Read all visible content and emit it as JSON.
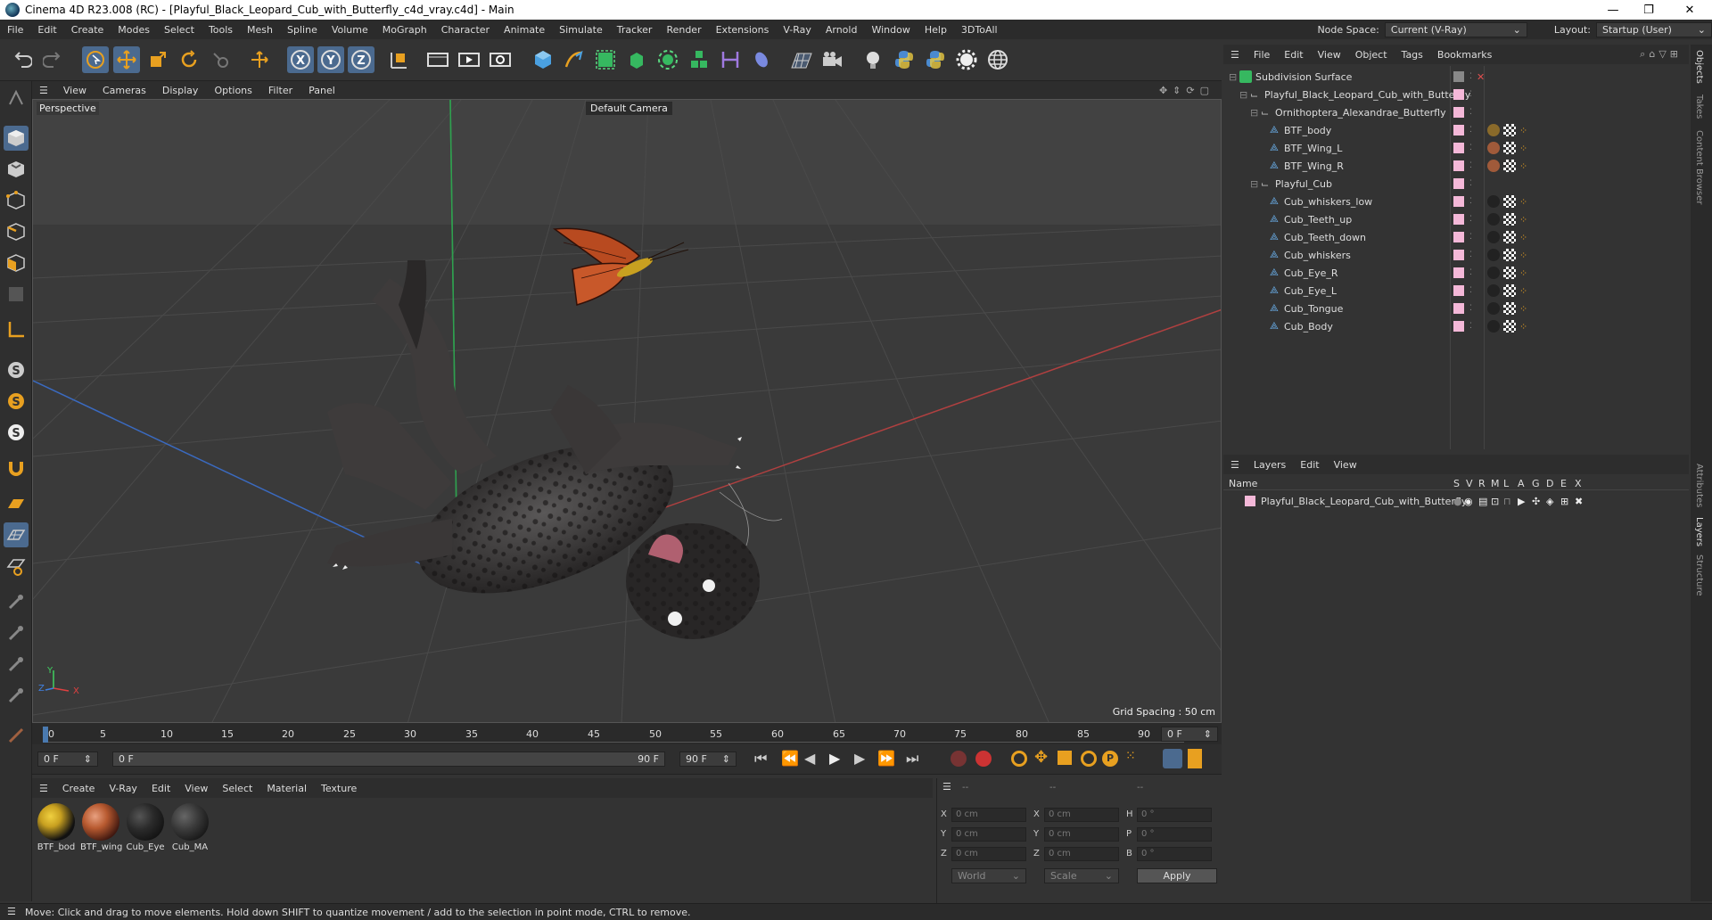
{
  "window": {
    "title": "Cinema 4D R23.008 (RC) - [Playful_Black_Leopard_Cub_with_Butterfly_c4d_vray.c4d] - Main",
    "minimize": "—",
    "maximize": "❐",
    "close": "✕"
  },
  "menubar": {
    "items": [
      "File",
      "Edit",
      "Create",
      "Modes",
      "Select",
      "Tools",
      "Mesh",
      "Spline",
      "Volume",
      "MoGraph",
      "Character",
      "Animate",
      "Simulate",
      "Tracker",
      "Render",
      "Extensions",
      "V-Ray",
      "Arnold",
      "Window",
      "Help",
      "3DToAll"
    ],
    "node_space_label": "Node Space:",
    "node_space_value": "Current (V-Ray)",
    "layout_label": "Layout:",
    "layout_value": "Startup (User)"
  },
  "viewport": {
    "menu": [
      "View",
      "Cameras",
      "Display",
      "Options",
      "Filter",
      "Panel"
    ],
    "view_name": "Perspective",
    "camera_name": "Default Camera",
    "grid_spacing": "Grid Spacing : 50 cm",
    "axis_y": "Y",
    "axis_x": "X",
    "axis_z": "Z"
  },
  "timeline": {
    "ticks": [
      "0",
      "5",
      "10",
      "15",
      "20",
      "25",
      "30",
      "35",
      "40",
      "45",
      "50",
      "55",
      "60",
      "65",
      "70",
      "75",
      "80",
      "85",
      "90"
    ],
    "current_frame_right": "0 F",
    "start_field": "0 F",
    "range_start": "0 F",
    "range_end": "90 F",
    "end_field": "90 F"
  },
  "materials": {
    "menu": [
      "Create",
      "V-Ray",
      "Edit",
      "View",
      "Select",
      "Material",
      "Texture"
    ],
    "items": [
      {
        "name": "BTF_bod",
        "color": "#c8a020"
      },
      {
        "name": "BTF_wing",
        "color": "#b85a30"
      },
      {
        "name": "Cub_Eye",
        "color": "#2a2a2a"
      },
      {
        "name": "Cub_MA",
        "color": "#3a3a3a"
      }
    ]
  },
  "coords": {
    "headers": [
      "--",
      "--",
      "--"
    ],
    "rows": [
      {
        "a": "X",
        "av": "0 cm",
        "b": "X",
        "bv": "0 cm",
        "c": "H",
        "cv": "0 °"
      },
      {
        "a": "Y",
        "av": "0 cm",
        "b": "Y",
        "bv": "0 cm",
        "c": "P",
        "cv": "0 °"
      },
      {
        "a": "Z",
        "av": "0 cm",
        "b": "Z",
        "bv": "0 cm",
        "c": "B",
        "cv": "0 °"
      }
    ],
    "space": "World",
    "mode": "Scale",
    "apply": "Apply"
  },
  "status": "Move: Click and drag to move elements. Hold down SHIFT to quantize movement / add to the selection in point mode, CTRL to remove.",
  "object_manager": {
    "menu": [
      "File",
      "Edit",
      "View",
      "Object",
      "Tags",
      "Bookmarks"
    ],
    "objects": [
      {
        "name": "Subdivision Surface",
        "depth": 0,
        "kind": "subdiv"
      },
      {
        "name": "Playful_Black_Leopard_Cub_with_Butterfly",
        "depth": 1,
        "kind": "null"
      },
      {
        "name": "Ornithoptera_Alexandrae_Butterfly",
        "depth": 2,
        "kind": "null"
      },
      {
        "name": "BTF_body",
        "depth": 3,
        "kind": "mesh",
        "tag": "#8a6a2a"
      },
      {
        "name": "BTF_Wing_L",
        "depth": 3,
        "kind": "mesh",
        "tag": "#a05a3a"
      },
      {
        "name": "BTF_Wing_R",
        "depth": 3,
        "kind": "mesh",
        "tag": "#a05a3a"
      },
      {
        "name": "Playful_Cub",
        "depth": 2,
        "kind": "null"
      },
      {
        "name": "Cub_whiskers_low",
        "depth": 3,
        "kind": "mesh",
        "tag": "#333"
      },
      {
        "name": "Cub_Teeth_up",
        "depth": 3,
        "kind": "mesh",
        "tag": "#333"
      },
      {
        "name": "Cub_Teeth_down",
        "depth": 3,
        "kind": "mesh",
        "tag": "#333"
      },
      {
        "name": "Cub_whiskers",
        "depth": 3,
        "kind": "mesh",
        "tag": "#333"
      },
      {
        "name": "Cub_Eye_R",
        "depth": 3,
        "kind": "mesh",
        "tag": "#333"
      },
      {
        "name": "Cub_Eye_L",
        "depth": 3,
        "kind": "mesh",
        "tag": "#333"
      },
      {
        "name": "Cub_Tongue",
        "depth": 3,
        "kind": "mesh",
        "tag": "#333"
      },
      {
        "name": "Cub_Body",
        "depth": 3,
        "kind": "mesh",
        "tag": "#333"
      }
    ]
  },
  "layers": {
    "menu": [
      "Layers",
      "Edit",
      "View"
    ],
    "col_name": "Name",
    "cols": [
      "S",
      "V",
      "R",
      "M",
      "L",
      "A",
      "G",
      "D",
      "E",
      "X"
    ],
    "rows": [
      {
        "name": "Playful_Black_Leopard_Cub_with_Butterfly",
        "color": "#f4b8d8"
      }
    ]
  },
  "side_tabs": [
    "Objects",
    "Takes",
    "Content Browser",
    "Attributes",
    "Layers",
    "Structure"
  ]
}
